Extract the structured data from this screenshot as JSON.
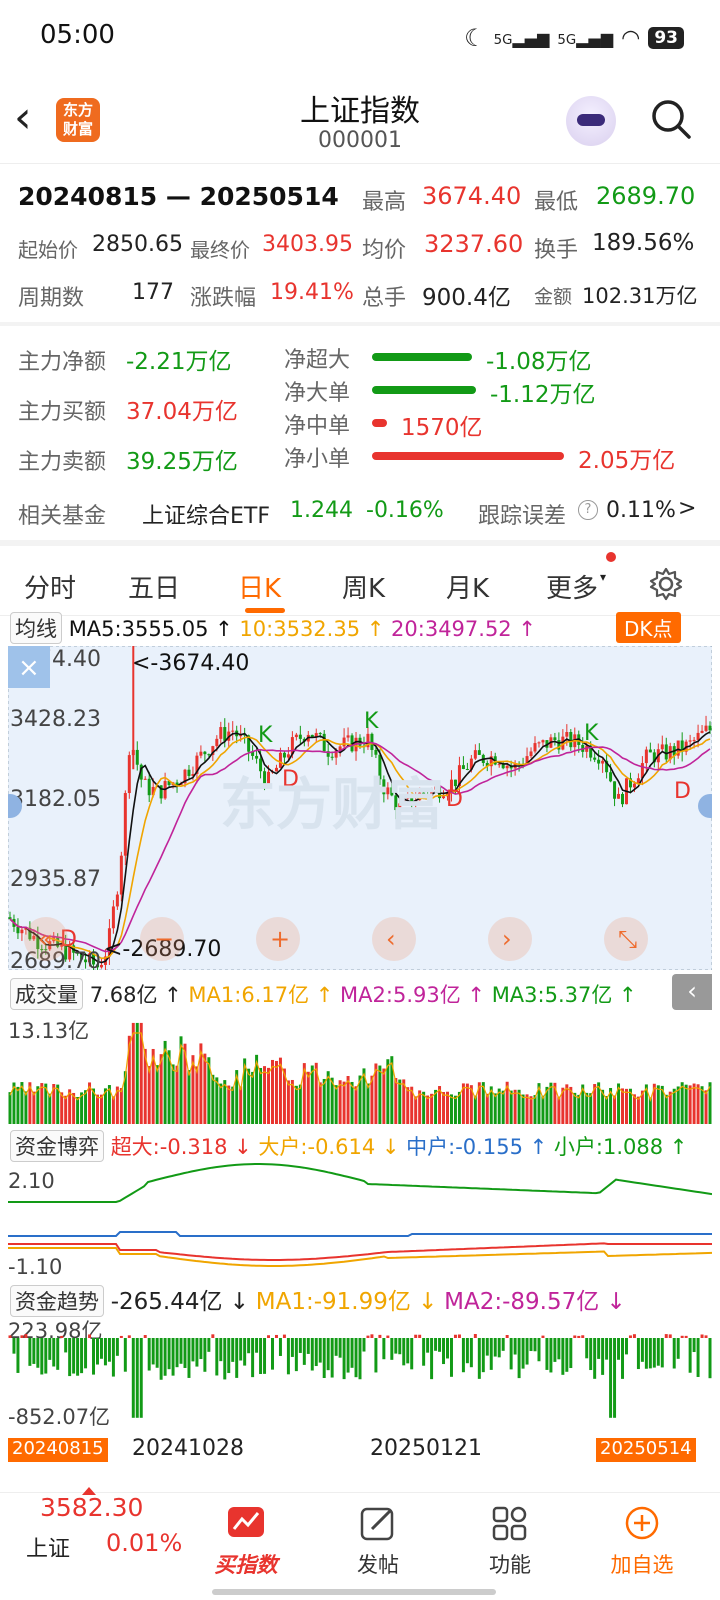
{
  "status": {
    "time": "05:00",
    "signal1": "5G",
    "signal2": "5G",
    "battery": "93"
  },
  "header": {
    "title": "上证指数",
    "code": "000001",
    "logo_line1": "东方",
    "logo_line2": "财富"
  },
  "summary": {
    "range": "20240815 — 20250514",
    "high_label": "最高",
    "high": "3674.40",
    "low_label": "最低",
    "low": "2689.70",
    "start_label": "起始价",
    "start": "2850.65",
    "end_label": "最终价",
    "end": "3403.95",
    "avg_label": "均价",
    "avg": "3237.60",
    "turnover_label": "换手",
    "turnover": "189.56%",
    "periods_label": "周期数",
    "periods": "177",
    "change_label": "涨跌幅",
    "change": "19.41%",
    "hands_label": "总手",
    "hands": "900.4亿",
    "amount_label": "金额",
    "amount": "102.31万亿"
  },
  "flow": {
    "net_label": "主力净额",
    "net": "-2.21万亿",
    "buy_label": "主力买额",
    "buy": "37.04万亿",
    "sell_label": "主力卖额",
    "sell": "39.25万亿",
    "rows": [
      {
        "label": "净超大",
        "value": "-1.08万亿",
        "ratio": 0.52,
        "color": "#129a16"
      },
      {
        "label": "净大单",
        "value": "-1.12万亿",
        "ratio": 0.54,
        "color": "#129a16"
      },
      {
        "label": "净中单",
        "value": "1570亿",
        "ratio": 0.08,
        "color": "#e8342e"
      },
      {
        "label": "净小单",
        "value": "2.05万亿",
        "ratio": 1.0,
        "color": "#e8342e"
      }
    ]
  },
  "fund": {
    "label": "相关基金",
    "name": "上证综合ETF",
    "price": "1.244",
    "change": "-0.16%",
    "err_label": "跟踪误差",
    "err": "0.11%",
    "chevron": ">"
  },
  "tabs": [
    "分时",
    "五日",
    "日K",
    "周K",
    "月K",
    "更多"
  ],
  "kline": {
    "ma_selector": "均线",
    "ma5": "MA5:3555.05 ↑",
    "ma10": "10:3532.35 ↑",
    "ma20": "20:3497.52 ↑",
    "dk_button": "DK点",
    "y_labels": [
      "3674.40",
      "3428.23",
      "3182.05",
      "2935.87",
      "2689.70"
    ],
    "high_marker": "<-3674.40",
    "low_marker": "<-2689.70",
    "signals": [
      "K",
      "D",
      "K",
      "D",
      "K",
      "D",
      "D"
    ],
    "watermark": "东方财富"
  },
  "volume": {
    "selector": "成交量",
    "value": "7.68亿 ↑",
    "ma1": "MA1:6.17亿 ↑",
    "ma2": "MA2:5.93亿 ↑",
    "ma3": "MA3:5.37亿 ↑",
    "ymax": "13.13亿"
  },
  "game": {
    "selector": "资金博弈",
    "super": "超大:-0.318 ↓",
    "large": "大户:-0.614 ↓",
    "mid": "中户:-0.155 ↑",
    "small": "小户:1.088 ↑",
    "ytop": "2.10",
    "ybottom": "-1.10"
  },
  "trend": {
    "selector": "资金趋势",
    "value": "-265.44亿 ↓",
    "ma1": "MA1:-91.99亿 ↓",
    "ma2": "MA2:-89.57亿 ↓",
    "ytop": "223.98亿",
    "ybottom": "-852.07亿"
  },
  "dates": [
    "20240815",
    "20241028",
    "20250121",
    "20250514"
  ],
  "bottom": {
    "index_price": "3582.30",
    "index_name": "上证",
    "index_change": "0.01%",
    "buy_index": "买指数",
    "post": "发帖",
    "func": "功能",
    "add": "加自选"
  },
  "colors": {
    "accent": "#ff6a00",
    "up": "#e8342e",
    "down": "#129a16",
    "ma5": "#111111",
    "ma10": "#f0a500",
    "ma20": "#c0249a"
  }
}
